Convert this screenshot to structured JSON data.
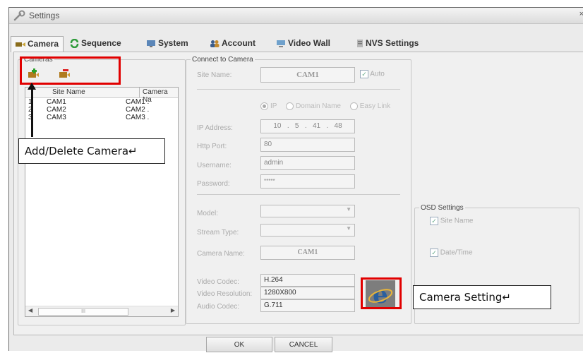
{
  "window": {
    "title": "Settings",
    "close_glyph": "×"
  },
  "tabs": [
    {
      "label": "Camera",
      "icon": "camera-icon",
      "active": true
    },
    {
      "label": "Sequence",
      "icon": "sequence-icon"
    },
    {
      "label": "System",
      "icon": "monitor-icon"
    },
    {
      "label": "Account",
      "icon": "users-icon"
    },
    {
      "label": "Video Wall",
      "icon": "video-wall-icon"
    },
    {
      "label": "NVS Settings",
      "icon": "nvs-icon"
    }
  ],
  "cameras_group": {
    "legend": "Cameras",
    "columns": [
      "Site Name",
      "Camera Na"
    ],
    "rows": [
      {
        "num": "1",
        "site": "CAM1",
        "camera": "CAM1 ."
      },
      {
        "num": "2",
        "site": "CAM2",
        "camera": "CAM2 ."
      },
      {
        "num": "3",
        "site": "CAM3",
        "camera": "CAM3 ."
      }
    ],
    "scroll_thumb": "III",
    "scroll_left": "◀",
    "scroll_right": "▶"
  },
  "connect": {
    "legend": "Connect to Camera",
    "site_name_label": "Site Name:",
    "site_name_value": "CAM1",
    "auto_label": "Auto",
    "radio_options": [
      "IP",
      "Domain Name",
      "Easy Link"
    ],
    "ip_label": "IP Address:",
    "ip_value": "10   .   5   .   41   .   48",
    "http_port_label": "Http Port:",
    "http_port_value": "80",
    "username_label": "Username:",
    "username_value": "admin",
    "password_label": "Password:",
    "password_value": "*****",
    "model_label": "Model:",
    "stream_type_label": "Stream Type:",
    "camera_name_label": "Camera Name:",
    "camera_name_value": "CAM1",
    "video_codec_label": "Video Codec:",
    "video_codec_value": "H.264",
    "video_resolution_label": "Video Resolution:",
    "video_resolution_value": "1280X800",
    "audio_codec_label": "Audio Codec:",
    "audio_codec_value": "G.711"
  },
  "osd": {
    "legend": "OSD Settings",
    "site_name_label": "Site Name",
    "datetime_label": "Date/Time"
  },
  "callouts": {
    "add_delete": "Add/Delete Camera↵",
    "camera_setting": "Camera Setting↵"
  },
  "buttons": {
    "ok": "OK",
    "cancel": "CANCEL"
  },
  "colors": {
    "highlight": "#e10000",
    "ie_icon": "#2b5f9e"
  }
}
